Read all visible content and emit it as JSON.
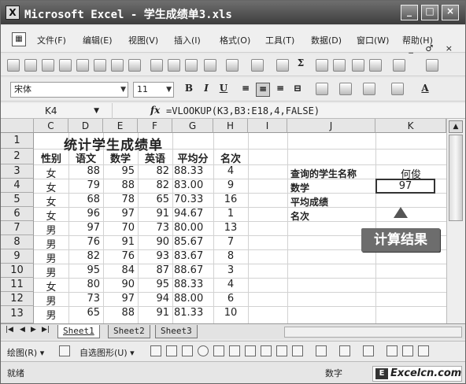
{
  "window": {
    "title": "Microsoft Excel - 学生成绩单3.xls",
    "app_icon": "X",
    "controls": [
      "_",
      "□",
      "×"
    ]
  },
  "menu": {
    "items": [
      "文件(F)",
      "编辑(E)",
      "视图(V)",
      "插入(I)",
      "格式(O)",
      "工具(T)",
      "数据(D)",
      "窗口(W)",
      "帮助(H)"
    ],
    "doc_controls": "_ ♂ ×"
  },
  "toolbar": {
    "font_name": "宋体",
    "font_size": "11",
    "bold": "B",
    "italic": "I",
    "underline": "U",
    "sigma": "Σ"
  },
  "formula_bar": {
    "name_box": "K4",
    "fx": "fx",
    "formula": "=VLOOKUP(K3,B3:E18,4,FALSE)"
  },
  "columns": [
    "C",
    "D",
    "E",
    "F",
    "G",
    "H",
    "I",
    "J",
    "K"
  ],
  "rows": [
    "1",
    "2",
    "3",
    "4",
    "5",
    "6",
    "7",
    "8",
    "9",
    "10",
    "11",
    "12",
    "13"
  ],
  "sheet": {
    "title": "统计学生成绩单",
    "headers": [
      "性别",
      "语文",
      "数学",
      "英语",
      "平均分",
      "名次"
    ],
    "data": [
      [
        "女",
        "88",
        "95",
        "82",
        "88.33",
        "4"
      ],
      [
        "女",
        "79",
        "88",
        "82",
        "83.00",
        "9"
      ],
      [
        "女",
        "68",
        "78",
        "65",
        "70.33",
        "16"
      ],
      [
        "女",
        "96",
        "97",
        "91",
        "94.67",
        "1"
      ],
      [
        "男",
        "97",
        "70",
        "73",
        "80.00",
        "13"
      ],
      [
        "男",
        "76",
        "91",
        "90",
        "85.67",
        "7"
      ],
      [
        "男",
        "82",
        "76",
        "93",
        "83.67",
        "8"
      ],
      [
        "男",
        "95",
        "84",
        "87",
        "88.67",
        "3"
      ],
      [
        "女",
        "80",
        "90",
        "95",
        "88.33",
        "4"
      ],
      [
        "男",
        "73",
        "97",
        "94",
        "88.00",
        "6"
      ],
      [
        "男",
        "65",
        "88",
        "91",
        "81.33",
        "10"
      ]
    ],
    "query": {
      "name_label": "查询的学生名称",
      "name_value": "何俊",
      "math_label": "数学",
      "math_value": "97",
      "avg_label": "平均成绩",
      "rank_label": "名次"
    }
  },
  "callout": "计算结果",
  "tabs": [
    "Sheet1",
    "Sheet2",
    "Sheet3"
  ],
  "drawbar": {
    "draw_label": "绘图(R) ▾",
    "autoshape_label": "自选图形(U) ▾"
  },
  "status": {
    "ready": "就绪",
    "num": "数字"
  },
  "watermark": {
    "mark": "E",
    "text": "Excelcn.com"
  }
}
